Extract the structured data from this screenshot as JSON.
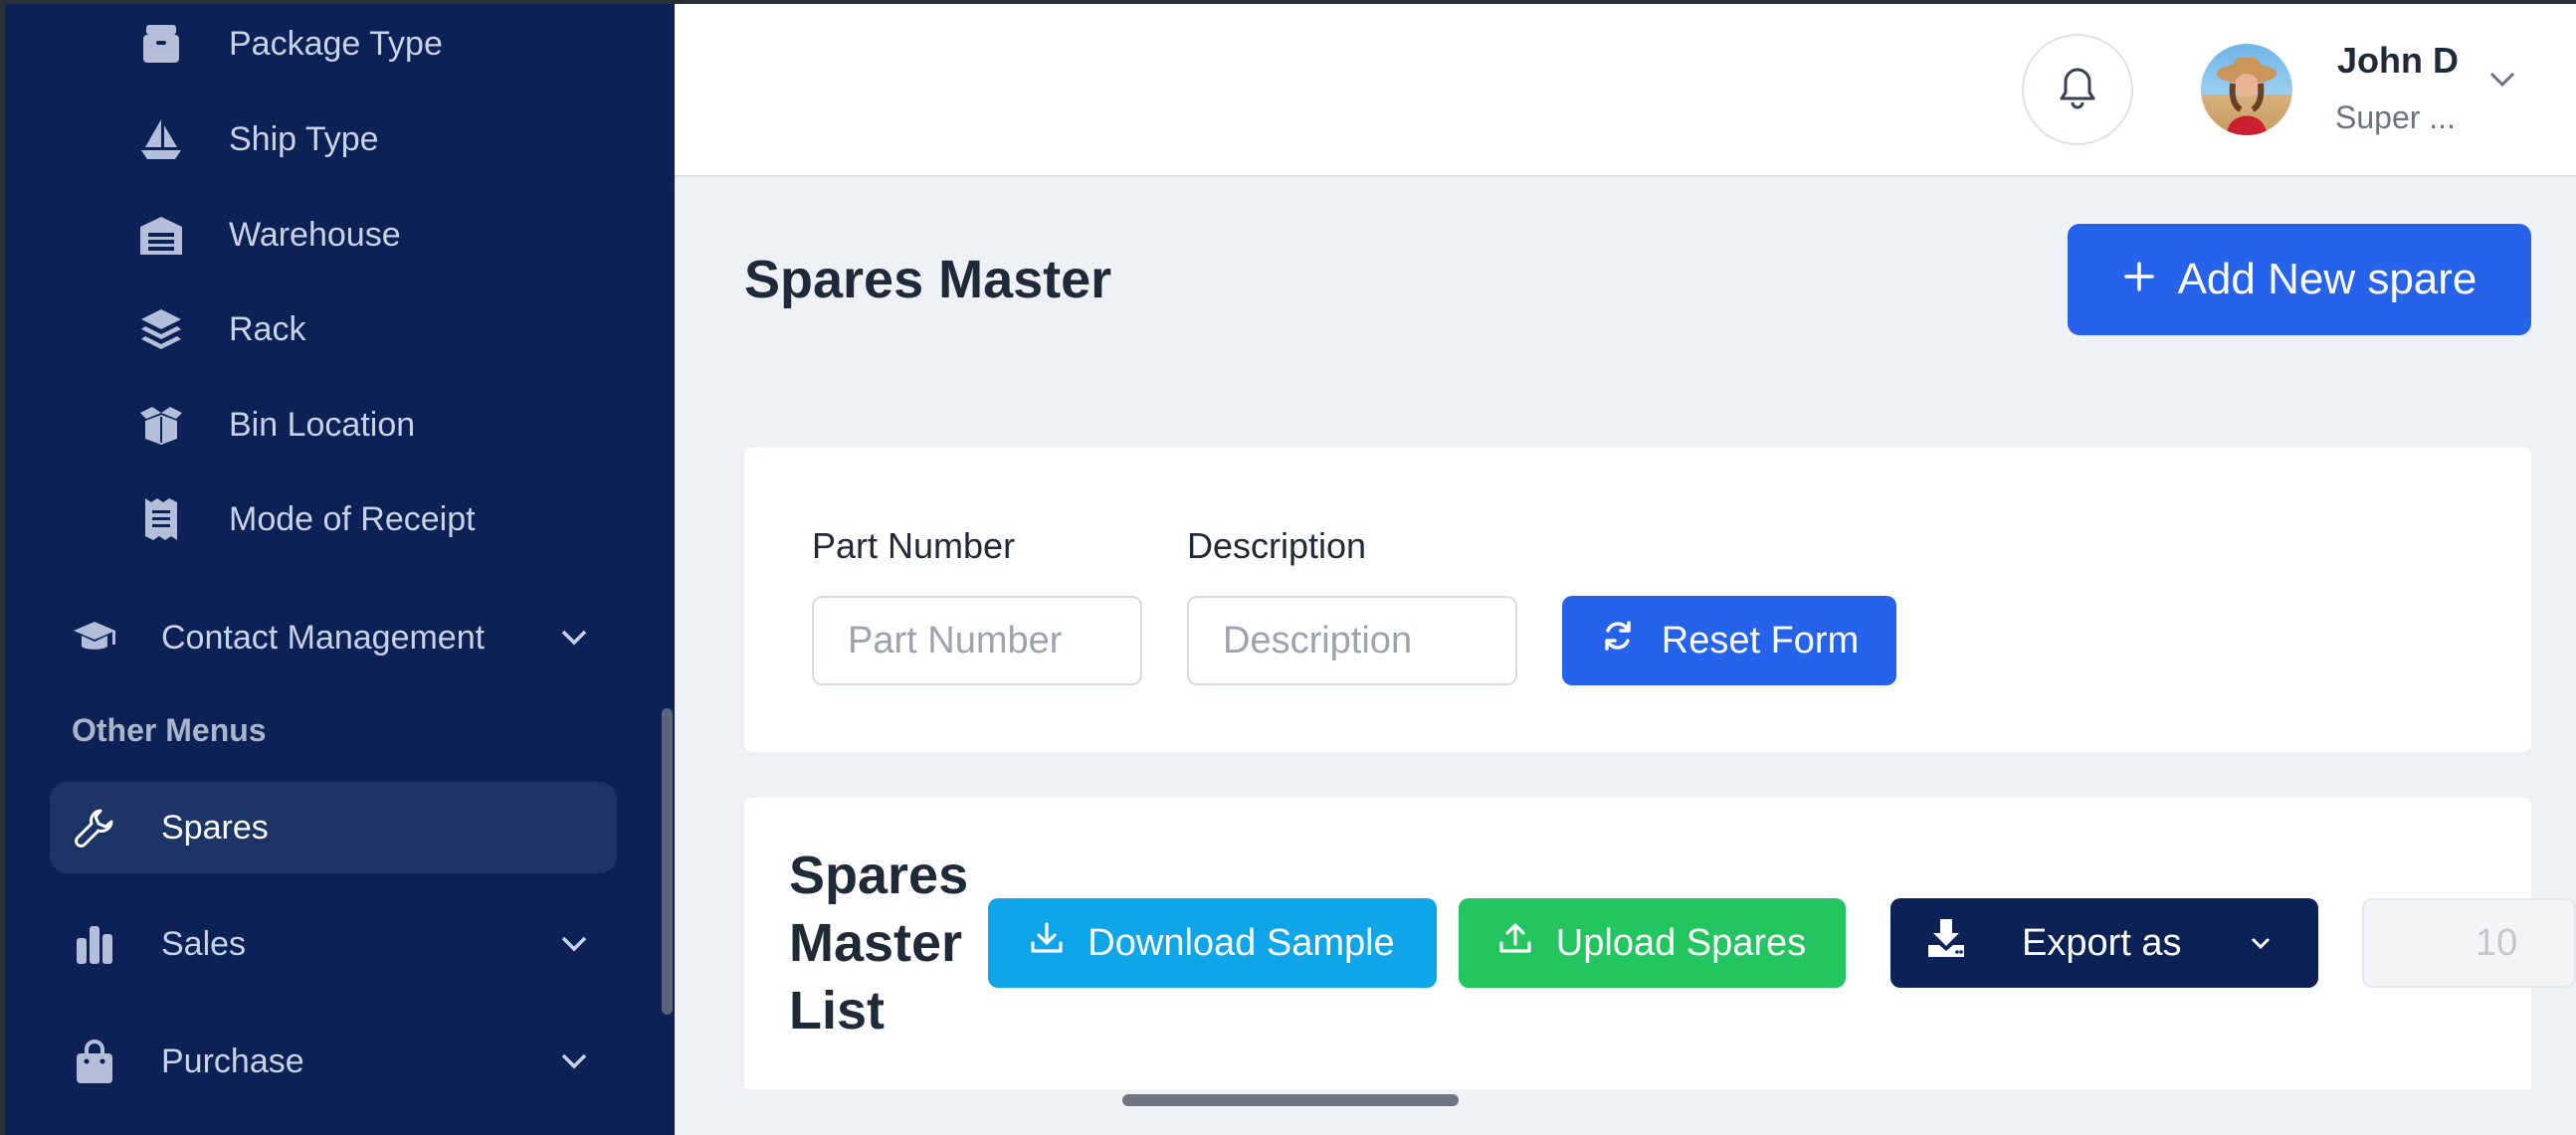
{
  "sidebar": {
    "sub_items": [
      {
        "label": "Package Type",
        "icon": "package-icon"
      },
      {
        "label": "Ship Type",
        "icon": "sailboat-icon"
      },
      {
        "label": "Warehouse",
        "icon": "warehouse-icon"
      },
      {
        "label": "Rack",
        "icon": "layers-icon"
      },
      {
        "label": "Bin Location",
        "icon": "box-open-icon"
      },
      {
        "label": "Mode of Receipt",
        "icon": "receipt-icon"
      }
    ],
    "contact_management": {
      "label": "Contact Management",
      "icon": "graduation-cap-icon"
    },
    "section_other": "Other Menus",
    "spares": {
      "label": "Spares",
      "icon": "wrench-icon"
    },
    "sales": {
      "label": "Sales",
      "icon": "bar-chart-icon"
    },
    "purchase": {
      "label": "Purchase",
      "icon": "shopping-bag-icon"
    },
    "colors": {
      "background": "#0c2257",
      "active": "#1d3566"
    }
  },
  "header": {
    "user_name": "John D",
    "user_role": "Super ..."
  },
  "main": {
    "title": "Spares Master",
    "add_button": "Add New spare",
    "filters": {
      "part_number_label": "Part Number",
      "part_number_placeholder": "Part Number",
      "part_number_value": "",
      "description_label": "Description",
      "description_placeholder": "Description",
      "description_value": "",
      "reset_button": "Reset Form"
    },
    "list": {
      "title": "Spares Master List",
      "download_button": "Download Sample",
      "upload_button": "Upload Spares",
      "export_button": "Export as",
      "page_size": "10"
    }
  },
  "colors": {
    "primary": "#2563eb",
    "download": "#0ea5e9",
    "upload": "#22c55e",
    "export": "#0c2257"
  }
}
